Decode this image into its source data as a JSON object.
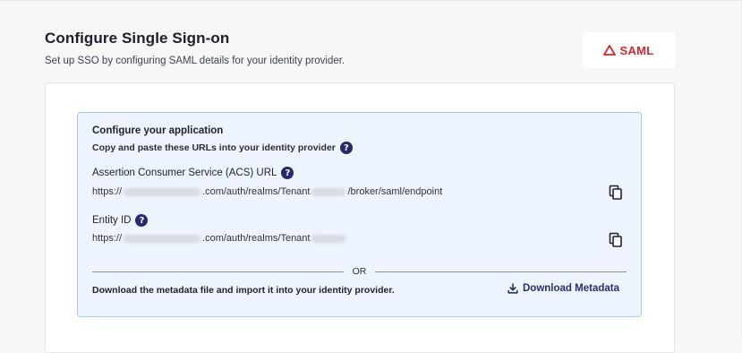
{
  "header": {
    "title": "Configure Single Sign-on",
    "subtitle": "Set up SSO by configuring SAML details for your identity provider."
  },
  "logo": {
    "text": "SAML",
    "color": "#d8262f"
  },
  "panel": {
    "title": "Configure your application",
    "subtitle": "Copy and paste these URLs into your identity provider",
    "acs": {
      "label": "Assertion Consumer Service (ACS) URL",
      "value_prefix": "https://",
      "value_middle": ".com/auth/realms/Tenant",
      "value_suffix": "/broker/saml/endpoint"
    },
    "entity": {
      "label": "Entity ID",
      "value_prefix": "https://",
      "value_middle": ".com/auth/realms/Tenant"
    },
    "divider_text": "OR",
    "metadata_text": "Download the metadata file and import it into your identity provider.",
    "download_label": "Download Metadata"
  },
  "icons": {
    "help": "help-circle-icon",
    "copy": "copy-icon",
    "download": "download-icon",
    "logo": "saml-logo-icon"
  },
  "colors": {
    "accent": "#262a6e",
    "panel_bg": "#edf4fd",
    "panel_border": "#a9c7e6"
  }
}
